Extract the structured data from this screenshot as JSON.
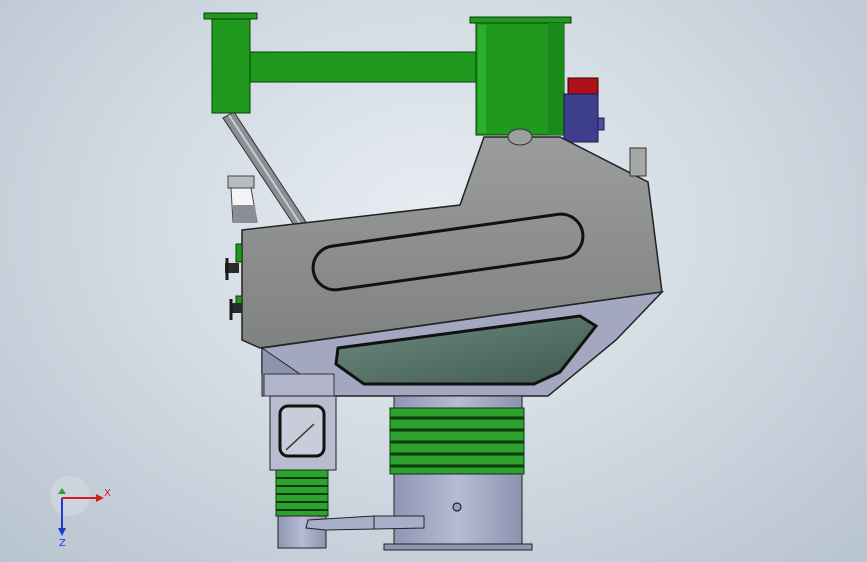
{
  "viewport": {
    "background_top": "#e8edf2",
    "background_bottom": "#b7c3ce",
    "model_colors": {
      "housing": "#8e9190",
      "housing_dark": "#6f7271",
      "ducting": "#1f9a1f",
      "ducting_dark": "#0f6b0f",
      "bellows": "#2fa12f",
      "base_steel": "#a9aec9",
      "window_glass": "#4c6a5f",
      "motor_cap": "#b0101a",
      "motor_body": "#3e3e8f"
    }
  },
  "triad": {
    "x_label": "X",
    "z_label": "Z",
    "x_color": "#d21e1e",
    "y_color": "#23a823",
    "z_color": "#1f3ad2"
  }
}
